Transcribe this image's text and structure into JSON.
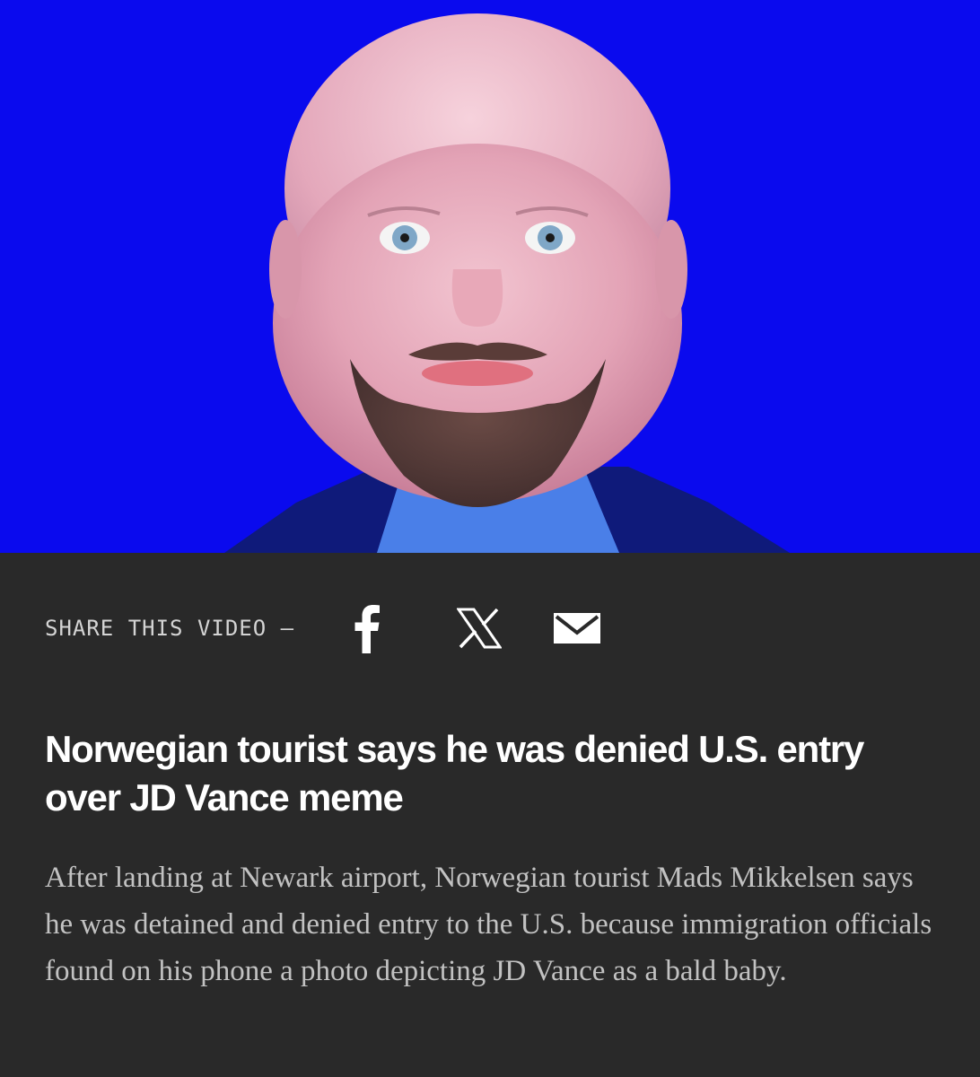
{
  "share": {
    "label": "SHARE THIS VIDEO —",
    "icons": [
      "facebook-icon",
      "x-icon",
      "mail-icon"
    ]
  },
  "article": {
    "headline": "Norwegian tourist says he was denied U.S. entry over JD Vance meme",
    "summary": "After landing at Newark airport, Norwegian tourist Mads Mikkelsen says he was detained and denied entry to the U.S. because immigration officials found on his phone a photo depicting JD Vance as a bald baby."
  },
  "colors": {
    "hero_background": "#0a0aee",
    "page_background": "#292929",
    "headline": "#ffffff",
    "summary": "#c2c2c2",
    "share_label": "#d4d4d4"
  }
}
